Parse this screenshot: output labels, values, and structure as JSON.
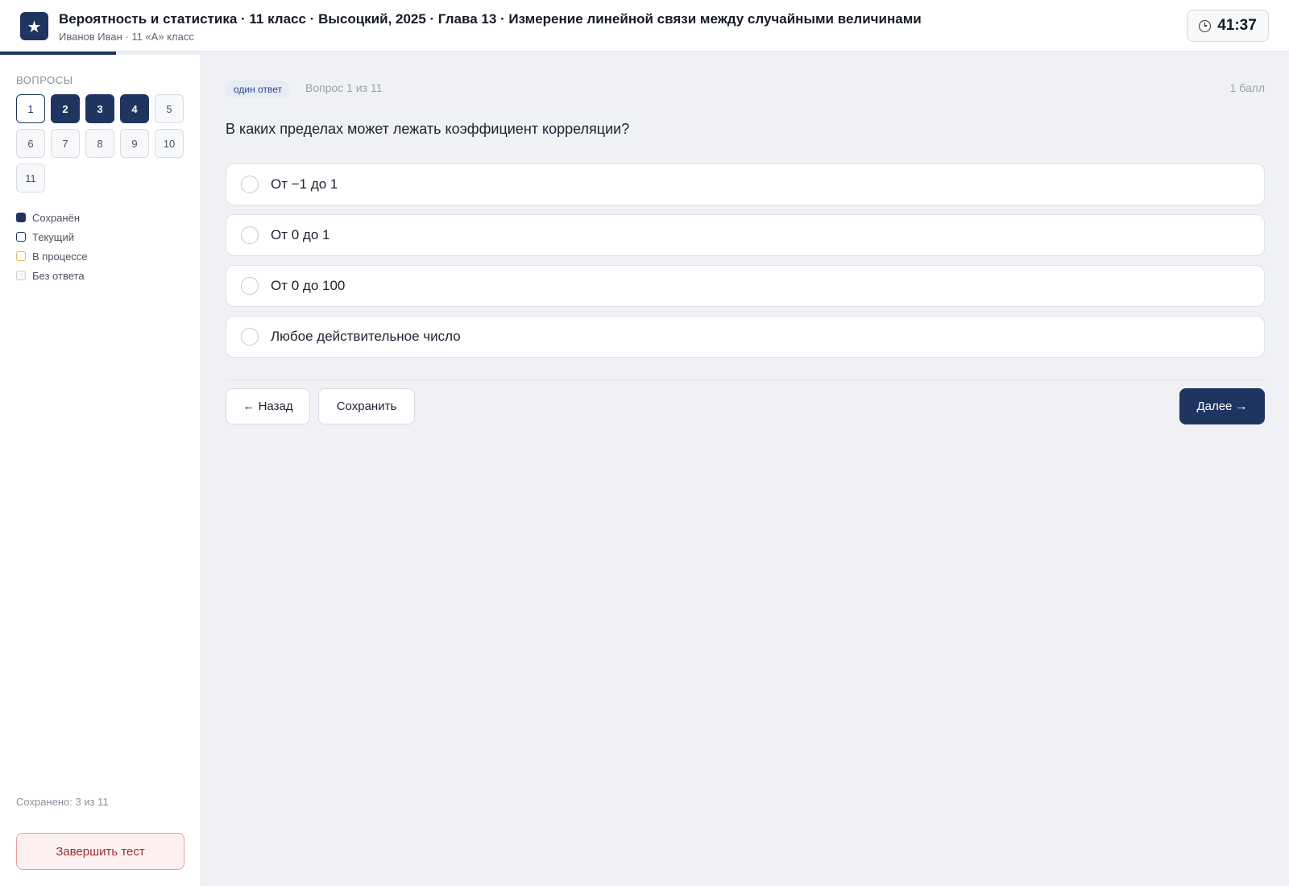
{
  "header": {
    "logo_glyph": "★",
    "title": "Вероятность и статистика · 11 класс · Высоцкий, 2025 · Глава 13 · Измерение линейной связи между случайными величинами",
    "subtitle": "Иванов Иван · 11 «А» класс",
    "timer": "41:37",
    "progress_fraction": 0.09
  },
  "sidebar": {
    "title": "ВОПРОСЫ",
    "questions": [
      {
        "label": "1",
        "state": "current"
      },
      {
        "label": "2",
        "state": "saved"
      },
      {
        "label": "3",
        "state": "saved"
      },
      {
        "label": "4",
        "state": "saved"
      },
      {
        "label": "5",
        "state": "none"
      },
      {
        "label": "6",
        "state": "none"
      },
      {
        "label": "7",
        "state": "none"
      },
      {
        "label": "8",
        "state": "none"
      },
      {
        "label": "9",
        "state": "none"
      },
      {
        "label": "10",
        "state": "none"
      },
      {
        "label": "11",
        "state": "none"
      }
    ],
    "legend": [
      {
        "label": "Сохранён",
        "kind": "saved"
      },
      {
        "label": "Текущий",
        "kind": "current"
      },
      {
        "label": "В процессе",
        "kind": "progress"
      },
      {
        "label": "Без ответа",
        "kind": "none"
      }
    ],
    "saved_count": "Сохранено: 3 из 11",
    "finish_label": "Завершить тест"
  },
  "question": {
    "type_badge": "один ответ",
    "counter": "Вопрос 1 из 11",
    "points": "1 балл",
    "text": "В каких пределах может лежать коэффициент корреляции?",
    "options": [
      "От −1 до 1",
      "От 0 до 1",
      "От 0 до 100",
      "Любое действительное число"
    ]
  },
  "nav": {
    "back_label": "← Назад",
    "save_label": "Сохранить",
    "next_label": "Далее →"
  },
  "colors": {
    "accent": "#1f3560",
    "in_progress": "#e8b55a",
    "danger": "#9b2f2f"
  }
}
